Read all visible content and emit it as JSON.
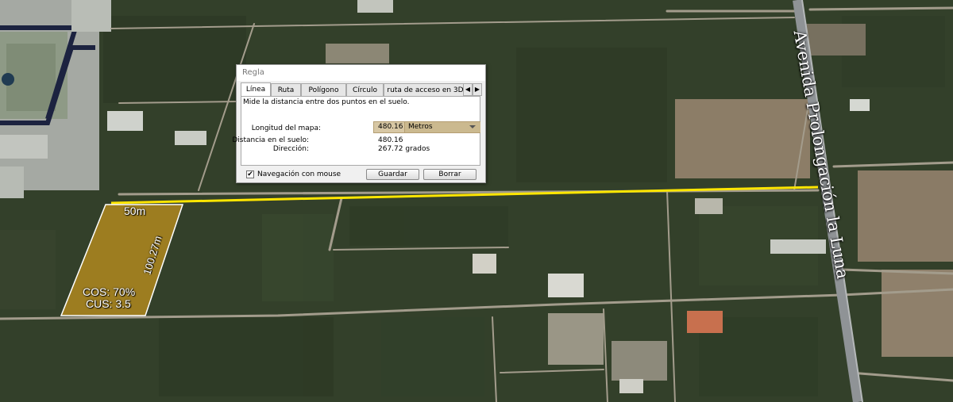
{
  "map": {
    "avenue_label": "Avenida Prolongación la Luna",
    "lot": {
      "width_label": "50m",
      "depth_label": "100.27m",
      "cos_label": "COS: 70%",
      "cus_label": "CUS: 3.5",
      "fill_color": "#a8841f"
    },
    "measure_line_color": "#ffe600"
  },
  "dialog": {
    "title": "Regla",
    "tabs": [
      "Línea",
      "Ruta",
      "Polígono",
      "Círculo",
      "ruta de acceso en 3D"
    ],
    "active_tab": "Línea",
    "description": "Mide la distancia entre dos puntos en el suelo.",
    "map_length_label": "Longitud del mapa:",
    "map_length_value": "480.16",
    "unit": "Metros",
    "ground_distance_label": "Distancia en el suelo:",
    "ground_distance_value": "480.16",
    "direction_label": "Dirección:",
    "direction_value": "267.72 grados",
    "mouse_nav_label": "Navegación con mouse",
    "mouse_nav_checked": true,
    "save_label": "Guardar",
    "clear_label": "Borrar"
  }
}
